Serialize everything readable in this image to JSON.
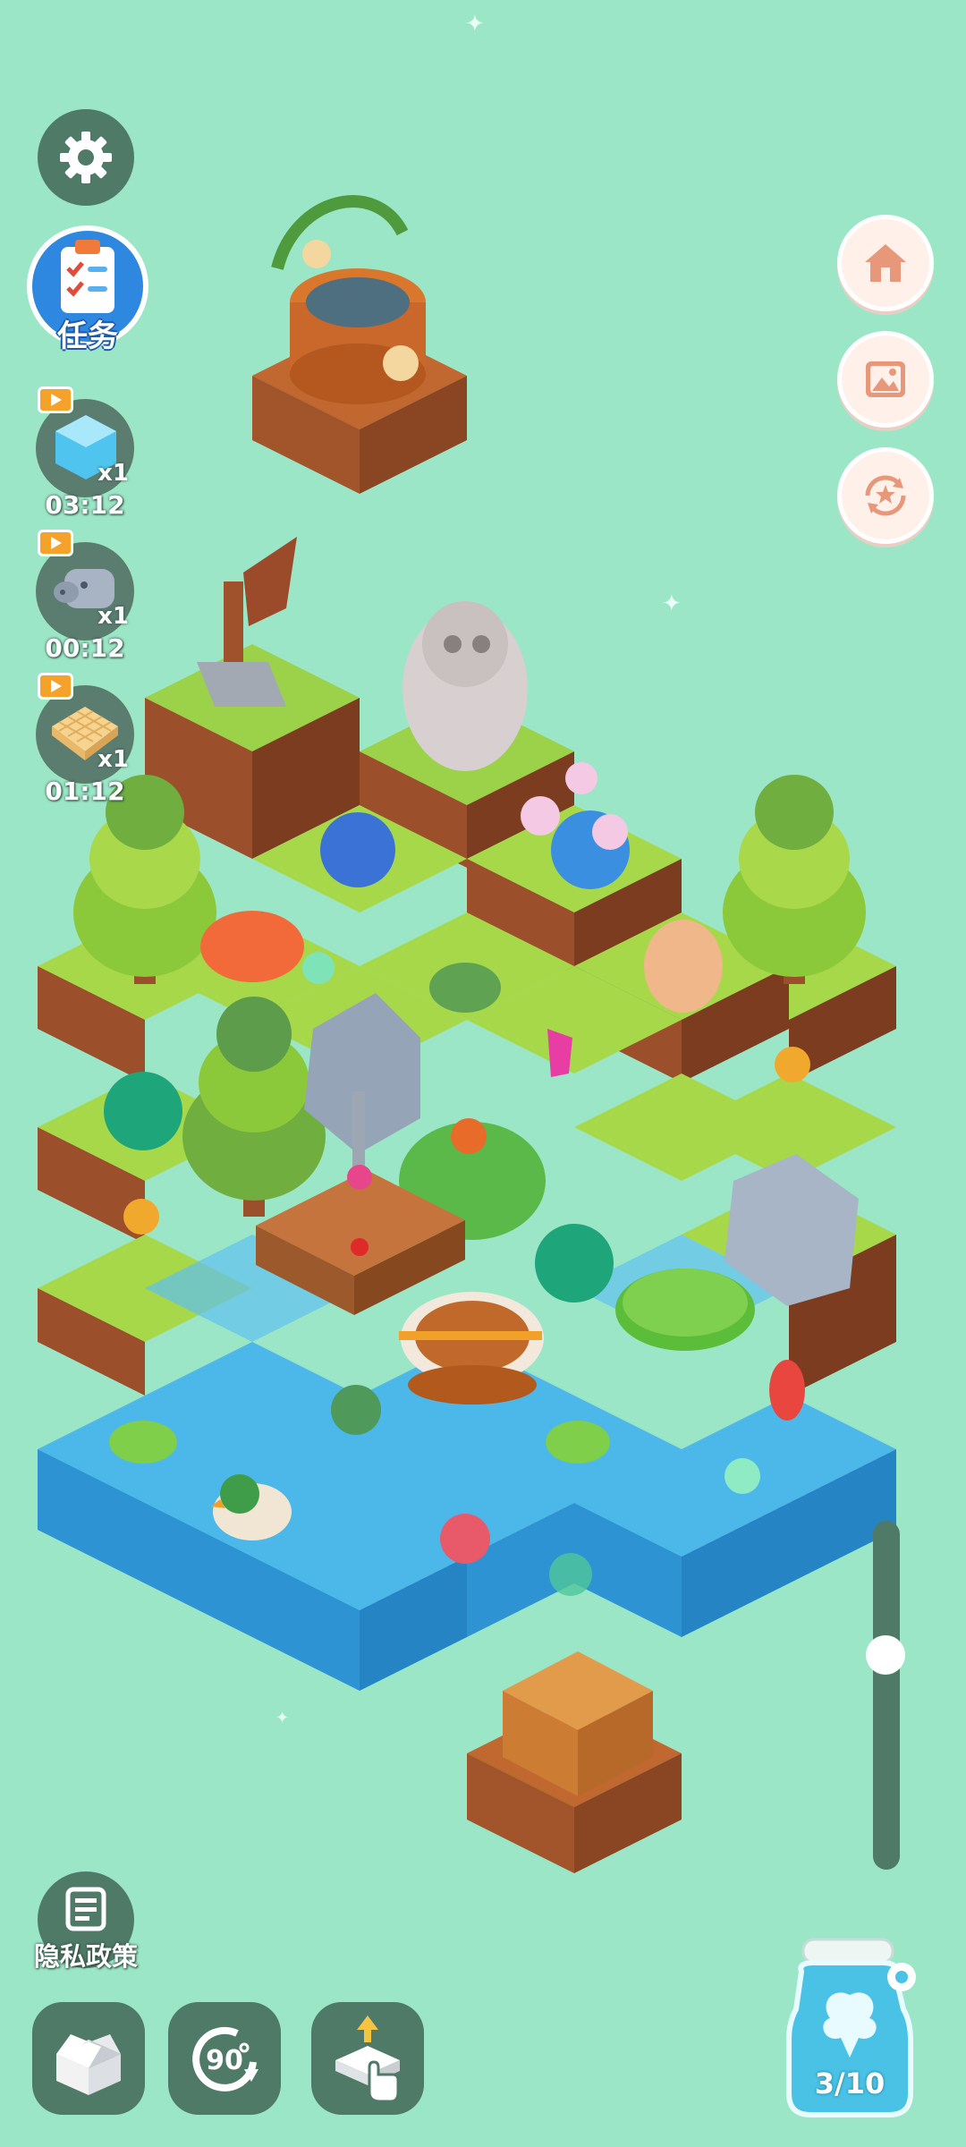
{
  "colors": {
    "background": "#9ce6c8",
    "button_dark": "#4f7a68",
    "task_blue": "#2f88e0",
    "right_button_bg": "#fff1ea",
    "right_button_icon": "#e8987a",
    "water": "#3aa9e8",
    "grass": "#a6d84a",
    "dirt": "#a7552d"
  },
  "sidebar_left": {
    "settings_icon": "gear-icon",
    "task": {
      "label": "任务",
      "icon": "clipboard-checklist-icon"
    },
    "boosters": [
      {
        "icon": "ice-block-icon",
        "video_icon": "video-ad-icon",
        "count": "x1",
        "timer": "03:12"
      },
      {
        "icon": "robot-pig-icon",
        "video_icon": "video-ad-icon",
        "count": "x1",
        "timer": "00:12"
      },
      {
        "icon": "wafer-biscuit-icon",
        "video_icon": "video-ad-icon",
        "count": "x1",
        "timer": "01:12"
      }
    ]
  },
  "sidebar_right": [
    {
      "icon": "home-icon"
    },
    {
      "icon": "picture-gallery-icon"
    },
    {
      "icon": "star-refresh-icon"
    }
  ],
  "privacy": {
    "label": "隐私政策",
    "icon": "policy-document-icon"
  },
  "bottom_bar": [
    {
      "icon": "open-box-icon"
    },
    {
      "icon": "rotate-90-icon",
      "label": "90"
    },
    {
      "icon": "tap-lift-tile-icon"
    }
  ],
  "zoom_slider": {
    "level": 0.37
  },
  "collection_jar": {
    "icon": "fairy-jar-icon",
    "count": "3/10"
  },
  "scene": {
    "type": "isometric-garden-island"
  }
}
